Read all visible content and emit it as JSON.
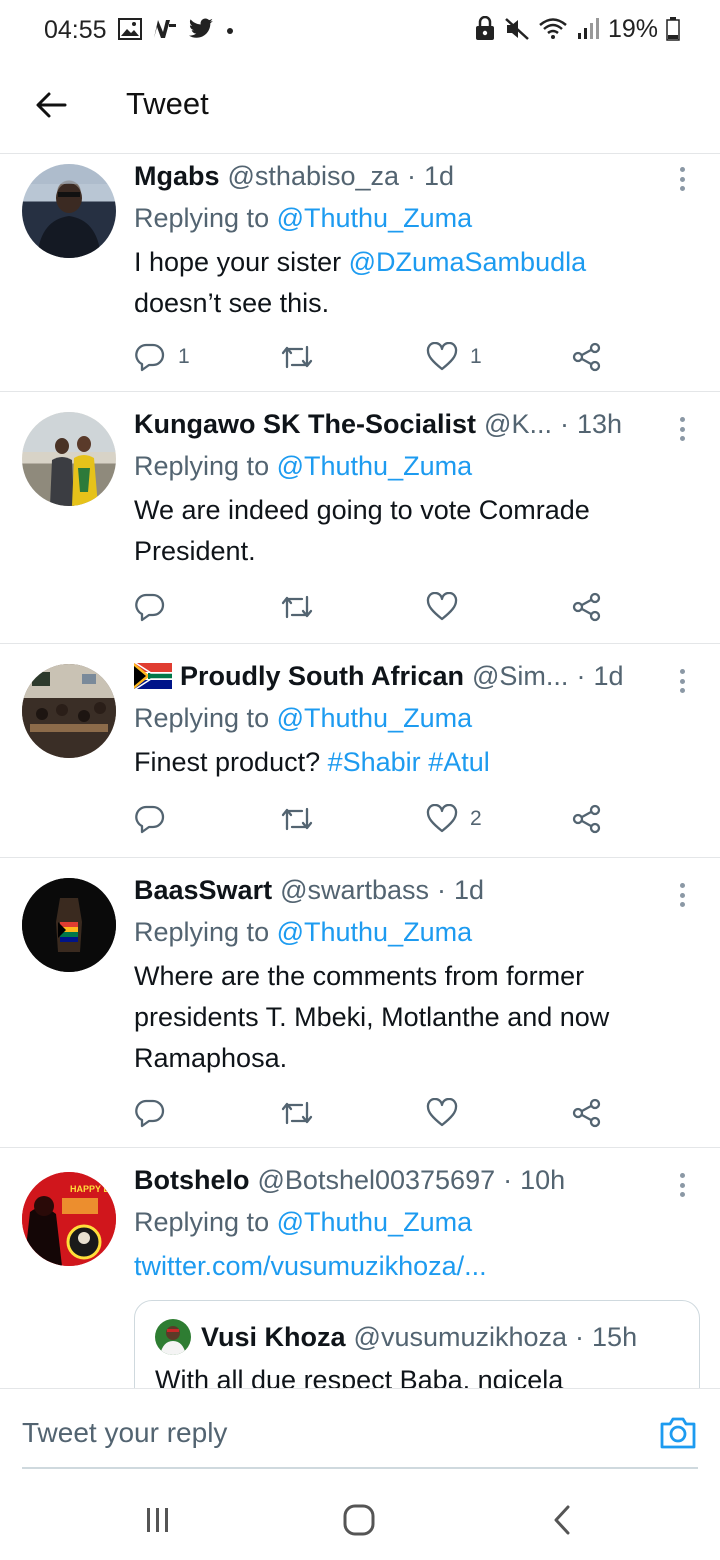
{
  "status_bar": {
    "time": "04:55",
    "battery": "19%",
    "left_icons": [
      "image-icon",
      "news-icon",
      "twitter-icon",
      "dot-icon"
    ],
    "right_icons": [
      "lock-icon",
      "mute-icon",
      "wifi-icon",
      "signal-icon",
      "battery-icon"
    ]
  },
  "header": {
    "title": "Tweet"
  },
  "tweets": [
    {
      "name": "Mgabs",
      "handle": "@sthabiso_za",
      "time": "1d",
      "replying_prefix": "Replying to",
      "replying_to": "@Thuthu_Zuma",
      "text_a": "I hope your sister ",
      "mention": "@DZumaSambudla",
      "text_b": "doesn’t see this.",
      "replies": "1",
      "retweets": "",
      "likes": "1"
    },
    {
      "name": "Kungawo SK The-Socialist",
      "handle": "@K...",
      "time": "13h",
      "replying_prefix": "Replying to",
      "replying_to": "@Thuthu_Zuma",
      "text_a": "We are indeed going to vote Comrade",
      "text_b": "President.",
      "replies": "",
      "retweets": "",
      "likes": ""
    },
    {
      "name": "Proudly South African",
      "handle": "@Sim...",
      "time": "1d",
      "replying_prefix": "Replying to",
      "replying_to": "@Thuthu_Zuma",
      "text_a": "Finest product? ",
      "hashtag1": "#Shabir",
      "hashtag2": "#Atul",
      "replies": "",
      "retweets": "",
      "likes": "2"
    },
    {
      "name": "BaasSwart",
      "handle": "@swartbass",
      "time": "1d",
      "replying_prefix": "Replying to",
      "replying_to": "@Thuthu_Zuma",
      "text_a": "Where are the comments from former",
      "text_b": "presidents T. Mbeki, Motlanthe and now",
      "text_c": "Ramaphosa.",
      "replies": "",
      "retweets": "",
      "likes": ""
    },
    {
      "name": "Botshelo",
      "handle": "@Botshel00375697",
      "time": "10h",
      "replying_prefix": "Replying to",
      "replying_to": "@Thuthu_Zuma",
      "link": "twitter.com/vusumuzikhoza/...",
      "quote": {
        "name": "Vusi Khoza",
        "handle": "@vusumuzikhoza",
        "time": "15h",
        "text": "With all due respect Baba, ngicela"
      },
      "avatar_caption": "HAPPY BIRTHDAY"
    }
  ],
  "reply_bar": {
    "placeholder": "Tweet your reply"
  },
  "colors": {
    "accent": "#1d9bf0",
    "muted": "#536471",
    "text": "#0f1419"
  }
}
